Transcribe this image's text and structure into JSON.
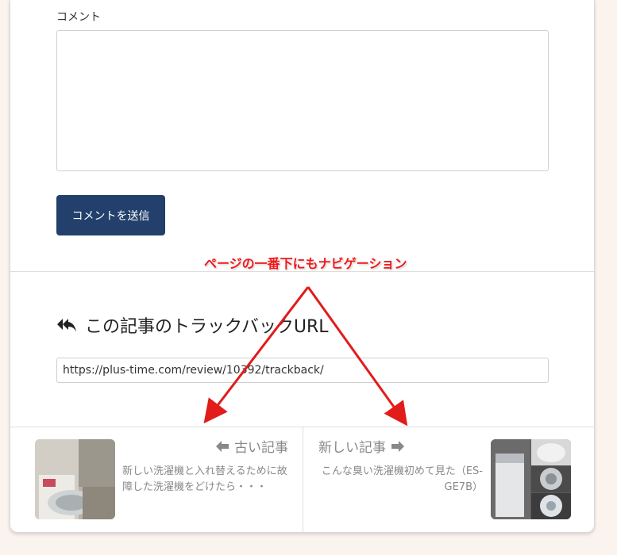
{
  "comment_form": {
    "label": "コメント",
    "textarea_value": "",
    "submit_label": "コメントを送信"
  },
  "trackback": {
    "title": "この記事のトラックバックURL",
    "url": "https://plus-time.com/review/10392/trackback/",
    "icon": "reply-all-icon"
  },
  "post_nav": {
    "older": {
      "heading": "古い記事",
      "icon": "arrow-left-icon",
      "title": "新しい洗濯機と入れ替えるために故障した洗濯機をどけたら・・・"
    },
    "newer": {
      "heading": "新しい記事",
      "icon": "arrow-right-icon",
      "title": "こんな臭い洗濯機初めて見た（ES-GE7B）"
    }
  },
  "annotation": {
    "text": "ページの一番下にもナビゲーション",
    "color": "#f01818"
  },
  "colors": {
    "button": "#22406b",
    "page_bg": "#fbf3ee",
    "nav_text": "#888888"
  }
}
